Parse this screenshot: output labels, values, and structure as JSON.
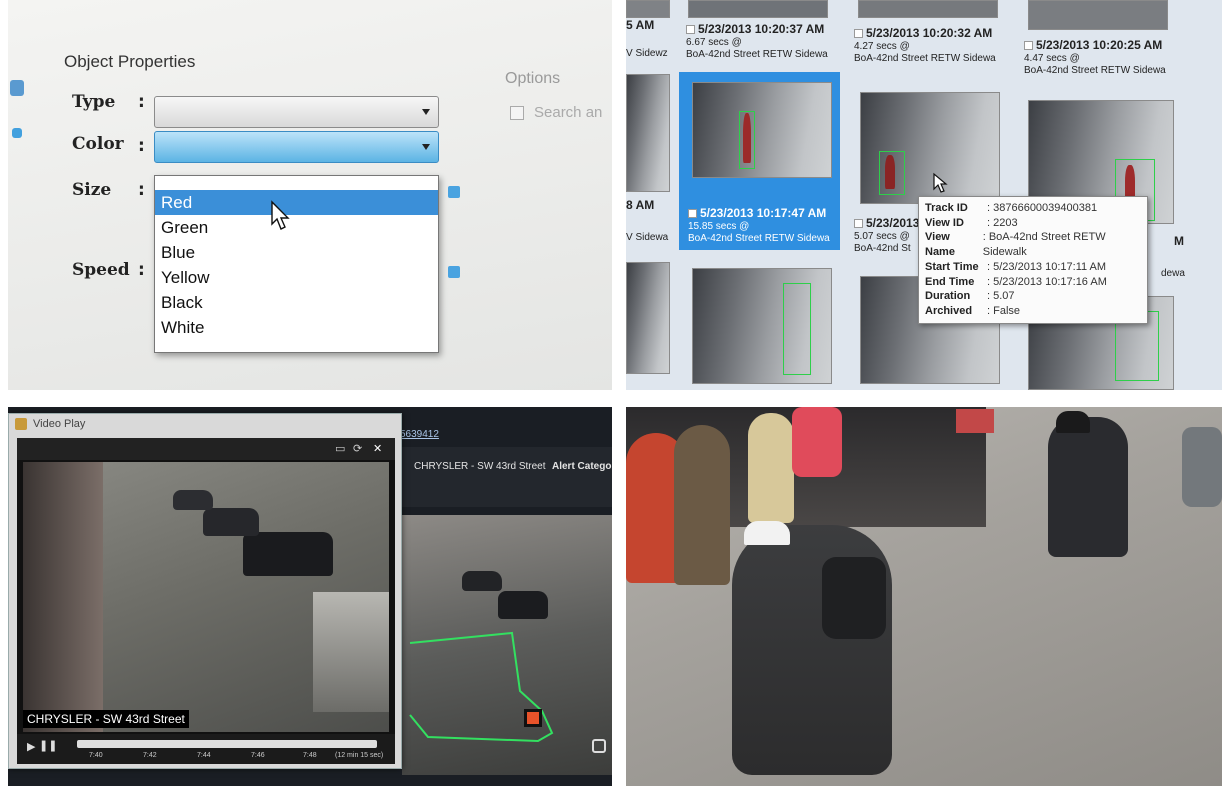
{
  "object_properties": {
    "title": "Object Properties",
    "labels": {
      "type": "Type",
      "color": "Color",
      "size": "Size",
      "speed": "Speed"
    },
    "colon": ":",
    "color_options": [
      "Red",
      "Green",
      "Blue",
      "Yellow",
      "Black",
      "White"
    ],
    "highlighted_option": "Red",
    "options_title": "Options",
    "options_checkbox_label": "Search an"
  },
  "results": {
    "tiles": [
      {
        "time": "5/23/2013 10:20:37 AM",
        "secs": "6.67 secs @",
        "view": "BoA-42nd Street RETW Sidewa"
      },
      {
        "time": "5/23/2013 10:20:32 AM",
        "secs": "4.27 secs @",
        "view": "BoA-42nd Street RETW Sidewa"
      },
      {
        "time": "5/23/2013 10:20:25 AM",
        "secs": "4.47 secs @",
        "view": "BoA-42nd Street RETW Sidewa"
      },
      {
        "time": "5/23/2013 10:17:47 AM",
        "secs": "15.85 secs @",
        "view": "BoA-42nd Street RETW Sidewa"
      },
      {
        "time": "5/23/2013",
        "secs": "5.07 secs @",
        "view": "BoA-42nd St"
      }
    ],
    "left_partial": {
      "am1": "5 AM",
      "side1": "V Sidewz",
      "am2": "8 AM",
      "side2": "V Sidewa"
    },
    "right_partial": {
      "m": "M",
      "sidewa": "dewa"
    },
    "tooltip": [
      {
        "key": "Track ID",
        "value": ": 38766600039400381"
      },
      {
        "key": "View ID",
        "value": ": 2203"
      },
      {
        "key": "View Name",
        "value": ": BoA-42nd Street RETW Sidewalk"
      },
      {
        "key": "Start Time",
        "value": ": 5/23/2013 10:17:11 AM"
      },
      {
        "key": "End Time",
        "value": ": 5/23/2013 10:17:16 AM"
      },
      {
        "key": "Duration",
        "value": ": 5.07"
      },
      {
        "key": "Archived",
        "value": ": False"
      }
    ]
  },
  "video_player": {
    "window_title": "Video Play",
    "camera_label": "CHRYSLER - SW 43rd Street",
    "timeline_ticks": [
      "7:40",
      "7:42",
      "7:44",
      "7:46",
      "7:48"
    ],
    "duration": "(12 min 15 sec)",
    "icons": [
      "minimize-icon",
      "maximize-icon",
      "close-icon",
      "play-icon",
      "pause-icon"
    ]
  },
  "alert_panel": {
    "link": "5639412",
    "camera": "CHRYSLER - SW 43rd Street",
    "alert_category": "Alert Catego"
  },
  "colors": {
    "selection_blue": "#3b8fd8",
    "tile_selected": "#2f8fe0",
    "track_green": "#2ecf4a",
    "alert_orange": "#e8532a"
  }
}
